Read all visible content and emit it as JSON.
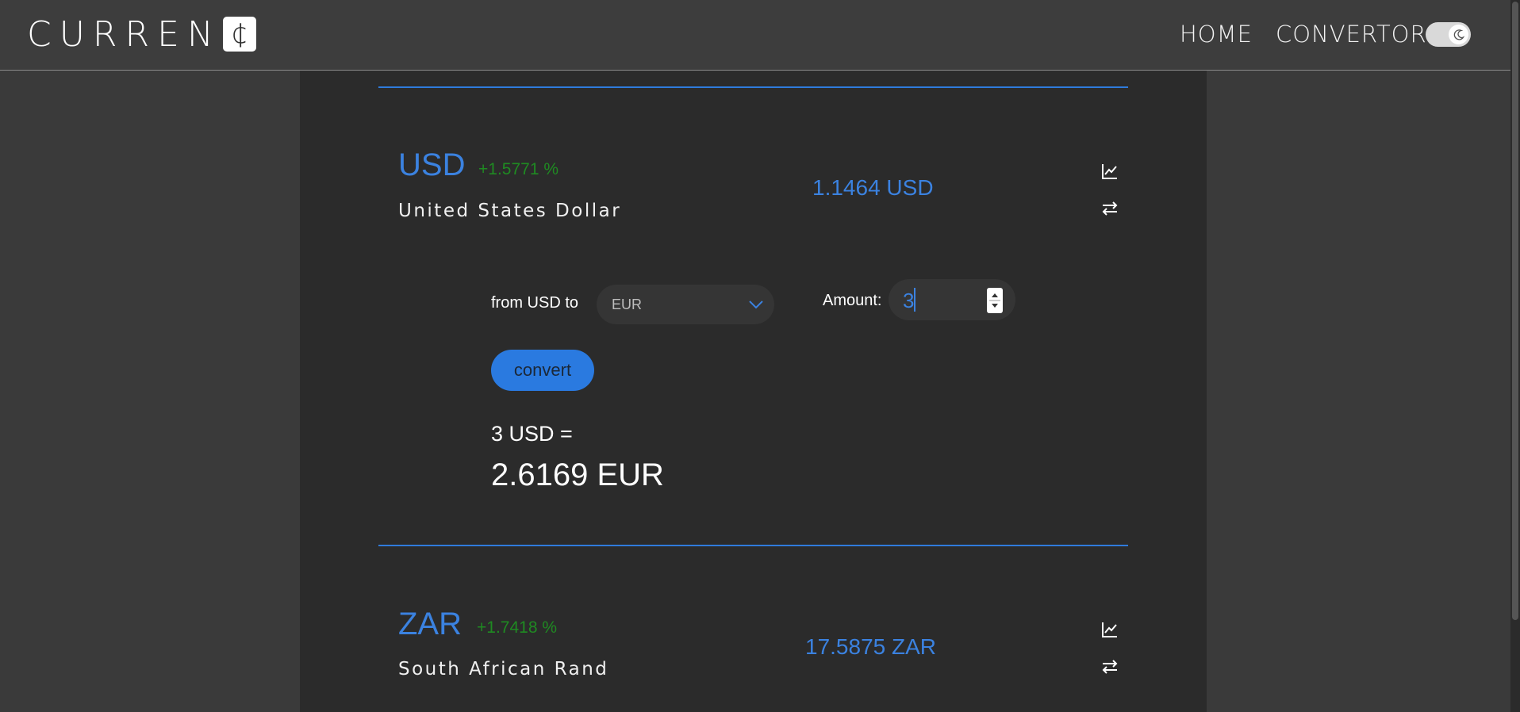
{
  "app": {
    "logo_text": "CURREN",
    "logo_mark": "¢"
  },
  "nav": {
    "home": "HOME",
    "convertor": "CONVERTOR",
    "theme_toggle_icon": "moon-icon"
  },
  "colors": {
    "accent": "#2f7bdc",
    "positive": "#1f8a22",
    "panel": "#2b2b2b",
    "background": "#3a3a3a"
  },
  "currencies": [
    {
      "code": "USD",
      "change": "+1.5771 %",
      "name": "United States Dollar",
      "rate": "1.1464 USD",
      "icons": [
        "chart-line-icon",
        "swap-icon"
      ]
    },
    {
      "code": "ZAR",
      "change": "+1.7418 %",
      "name": "South African Rand",
      "rate": "17.5875 ZAR",
      "icons": [
        "chart-line-icon",
        "swap-icon"
      ]
    }
  ],
  "converter": {
    "from_label": "from USD to",
    "to_currency": "EUR",
    "amount_label": "Amount:",
    "amount_value": "3",
    "convert_label": "convert",
    "result_from": "3 USD =",
    "result_to": "2.6169 EUR"
  }
}
